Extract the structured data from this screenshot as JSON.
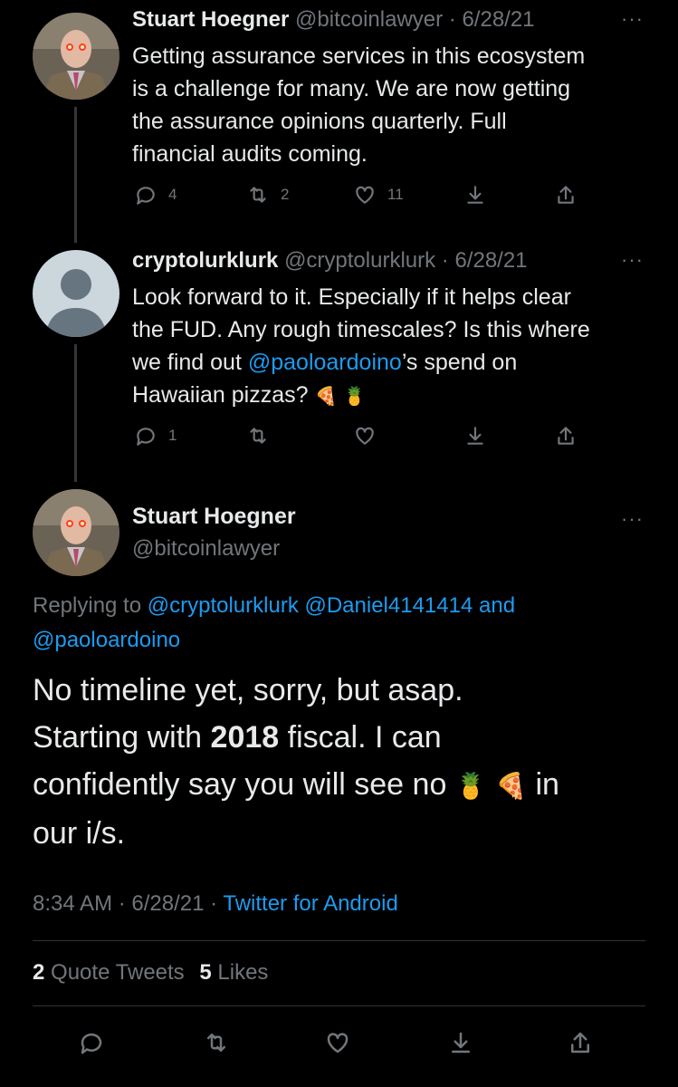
{
  "colors": {
    "background": "#000000",
    "text": "#e7e9ea",
    "muted": "#71767b",
    "link": "#1d9bf0",
    "divider": "#2f3336"
  },
  "tweet1": {
    "name": "Stuart Hoegner",
    "handle": "@bitcoinlawyer",
    "date": "· 6/28/21",
    "more": "···",
    "lines": [
      "Getting assurance services in this ecosystem",
      "is a challenge for many. We are now getting",
      "the assurance opinions quarterly. Full",
      "financial audits coming."
    ],
    "reply_count": "4",
    "retweet_count": "2",
    "like_count": "11"
  },
  "tweet2": {
    "name": "cryptolurklurk",
    "handle": "@cryptolurklurk",
    "date": "· 6/28/21",
    "more": "···",
    "line1": "Look forward to it. Especially if it helps clear",
    "line2": "the FUD. Any rough timescales? Is this where",
    "line3_pre": "we find out ",
    "line3_mention": "@paoloardoino",
    "line3_post": "’s spend on",
    "line4": "Hawaiian pizzas?",
    "emoji_pizza": "🍕",
    "emoji_pineapple": "🍍",
    "reply_count": "1"
  },
  "main": {
    "name": "Stuart Hoegner",
    "handle": "@bitcoinlawyer",
    "more": "···",
    "replying_to_label": "Replying to",
    "mention1": "@cryptolurklurk",
    "mention2": "@Daniel4141414",
    "and_label": "and",
    "mention3": "@paoloardoino",
    "line1": "No timeline yet, sorry, but asap.",
    "line2_pre": "Starting with ",
    "line2_bold": "2018",
    "line2_post": " fiscal. I can",
    "line3_pre": "confidently say you will see no ",
    "emoji_pineapple": "🍍",
    "emoji_pizza": "🍕",
    "line3_post": " in",
    "line4": "our i/s.",
    "time": "8:34 AM",
    "date": "· 6/28/21 ·",
    "source": "Twitter for Android",
    "quote_count": "2",
    "quote_label": "Quote Tweets",
    "like_count": "5",
    "like_label": "Likes"
  },
  "icons": [
    "reply-icon",
    "retweet-icon",
    "like-icon",
    "bookmark-icon",
    "share-icon"
  ]
}
